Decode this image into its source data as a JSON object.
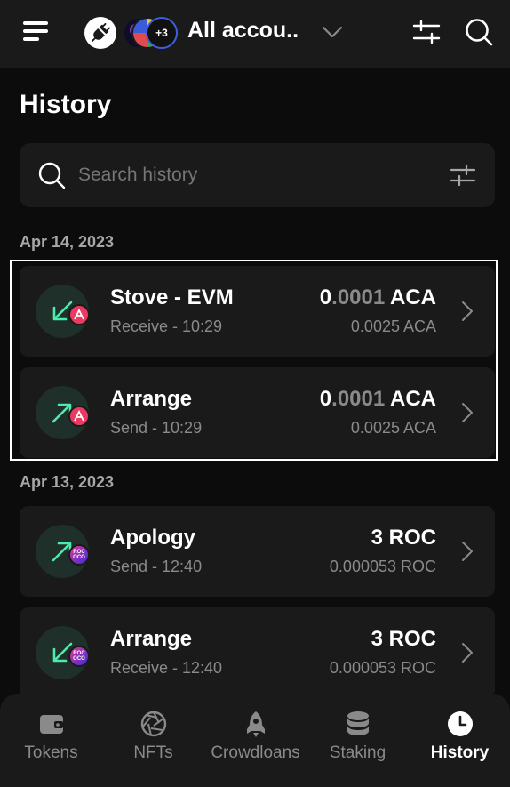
{
  "header": {
    "account_selector": "All accou...",
    "extra_accounts_badge": "+3",
    "icons": [
      "menu-icon",
      "plug-icon",
      "chevron-down-icon",
      "filter-icon",
      "search-icon"
    ]
  },
  "page": {
    "title": "History"
  },
  "search": {
    "placeholder": "Search history"
  },
  "groups": [
    {
      "date": "Apr 14, 2023",
      "items": [
        {
          "name": "Stove - EVM",
          "direction": "receive",
          "subtitle": "Receive - 10:29",
          "amount_int": "0",
          "amount_dec": ".0001",
          "amount_symbol": "ACA",
          "fee": "0.0025 ACA",
          "chain_icon": "acala-icon"
        },
        {
          "name": "Arrange",
          "direction": "send",
          "subtitle": "Send - 10:29",
          "amount_int": "0",
          "amount_dec": ".0001",
          "amount_symbol": "ACA",
          "fee": "0.0025 ACA",
          "chain_icon": "acala-icon"
        }
      ]
    },
    {
      "date": "Apr 13, 2023",
      "items": [
        {
          "name": "Apology",
          "direction": "send",
          "subtitle": "Send - 12:40",
          "amount_int": "3",
          "amount_dec": "",
          "amount_symbol": "ROC",
          "fee": "0.000053 ROC",
          "chain_icon": "rococo-icon",
          "chain_text": "ROC\nOCO"
        },
        {
          "name": "Arrange",
          "direction": "receive",
          "subtitle": "Receive - 12:40",
          "amount_int": "3",
          "amount_dec": "",
          "amount_symbol": "ROC",
          "fee": "0.000053 ROC",
          "chain_icon": "rococo-icon",
          "chain_text": "ROC\nOCO"
        }
      ]
    }
  ],
  "tabs": [
    {
      "label": "Tokens",
      "icon": "wallet-icon",
      "active": false
    },
    {
      "label": "NFTs",
      "icon": "aperture-icon",
      "active": false
    },
    {
      "label": "Crowdloans",
      "icon": "rocket-icon",
      "active": false
    },
    {
      "label": "Staking",
      "icon": "database-icon",
      "active": false
    },
    {
      "label": "History",
      "icon": "clock-icon",
      "active": true
    }
  ],
  "colors": {
    "background": "#0c0c0c",
    "surface": "#1a1a1a",
    "accent_green": "#4ceaac",
    "muted_text": "#8a8a8a",
    "acala_red": "#e83a62"
  }
}
